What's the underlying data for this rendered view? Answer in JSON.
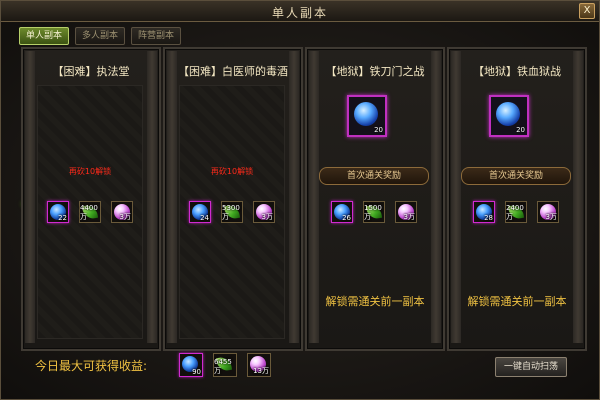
{
  "window": {
    "title": "单人副本",
    "close_label": "X"
  },
  "tabs": [
    {
      "label": "单人副本",
      "active": true
    },
    {
      "label": "多人副本",
      "active": false
    },
    {
      "label": "阵营副本",
      "active": false
    }
  ],
  "panels": [
    {
      "title": "【困难】执法堂",
      "note": "再砍10解锁",
      "rewards": [
        {
          "type": "orb",
          "count": "22"
        },
        {
          "type": "leaf",
          "count": "4400万"
        },
        {
          "type": "pearl",
          "count": "3万"
        }
      ]
    },
    {
      "title": "【困难】白医师的毒酒",
      "note": "再砍10解锁",
      "rewards": [
        {
          "type": "orb",
          "count": "24"
        },
        {
          "type": "leaf",
          "count": "5300万"
        },
        {
          "type": "pearl",
          "count": "3万"
        }
      ]
    },
    {
      "title": "【地狱】铁刀门之战",
      "first_clear_count": "20",
      "first_clear_label": "首次通关奖励",
      "locked_text": "解锁需通关前一副本",
      "rewards": [
        {
          "type": "orb",
          "count": "26"
        },
        {
          "type": "leaf",
          "count": "1500万"
        },
        {
          "type": "pearl",
          "count": "3万"
        }
      ]
    },
    {
      "title": "【地狱】铁血狱战",
      "first_clear_count": "20",
      "first_clear_label": "首次通关奖励",
      "locked_text": "解锁需通关前一副本",
      "rewards": [
        {
          "type": "orb",
          "count": "28"
        },
        {
          "type": "leaf",
          "count": "2400万"
        },
        {
          "type": "pearl",
          "count": "3万"
        }
      ]
    }
  ],
  "footer": {
    "label": "今日最大可获得收益:",
    "rewards": [
      {
        "type": "orb",
        "count": "90"
      },
      {
        "type": "leaf",
        "count": "6455万"
      },
      {
        "type": "pearl",
        "count": "13万"
      }
    ],
    "sweep_button": "一键自动扫荡"
  },
  "colors": {
    "accent": "#7fd035",
    "gold_text": "#f0c242",
    "warning": "#ff2a1a",
    "rare_border": "#d02ad0"
  }
}
